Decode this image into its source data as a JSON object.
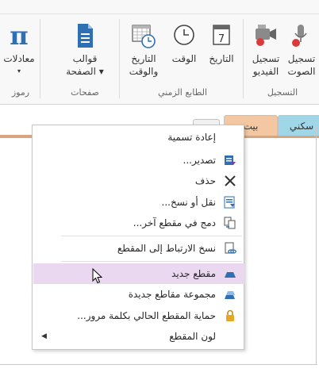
{
  "ribbon": {
    "buttons": {
      "equations": {
        "label": "معادلات",
        "sub": "▾"
      },
      "page_templates": {
        "label": "قوالب",
        "label2": "الصفحة ▾"
      },
      "date_time": {
        "label": "التاريخ",
        "label2": "والوقت"
      },
      "time": {
        "label": "الوقت"
      },
      "date": {
        "label": "التاريخ"
      },
      "record_video": {
        "label": "تسجيل",
        "label2": "الفيديو"
      },
      "record_audio": {
        "label": "تسجيل",
        "label2": "الصوت"
      }
    },
    "groups": {
      "symbols": "رموز",
      "pages": "صفحات",
      "timestamp": "الطابع الزمني",
      "recording": "التسجيل"
    }
  },
  "tabs": {
    "home": "بيت",
    "living": "سكني"
  },
  "context_menu": {
    "items": [
      {
        "label": "إعادة تسمية",
        "icon": "none"
      },
      {
        "label": "تصدير...",
        "icon": "export-icon"
      },
      {
        "label": "حذف",
        "icon": "delete-x-icon"
      },
      {
        "label": "نقل أو نسخ...",
        "icon": "move-copy-icon"
      },
      {
        "label": "دمج في مقطع آخر...",
        "icon": "merge-icon"
      },
      {
        "label": "نسخ الارتباط إلى المقطع",
        "icon": "copy-link-icon"
      },
      {
        "label": "مقطع جديد",
        "icon": "new-section-icon"
      },
      {
        "label": "مجموعة مقاطع جديدة",
        "icon": "new-section-group-icon"
      },
      {
        "label": "حماية المقطع الحالي بكلمة مرور...",
        "icon": "lock-icon"
      },
      {
        "label": "لون المقطع",
        "icon": "none",
        "submenu_arrow": "◀"
      }
    ],
    "highlighted_index": 6
  },
  "colors": {
    "home_tab": "#f2c7a2",
    "living_tab": "#9fd6e8",
    "highlight": "#ead7f0",
    "accent_blue": "#2f6fb4"
  }
}
